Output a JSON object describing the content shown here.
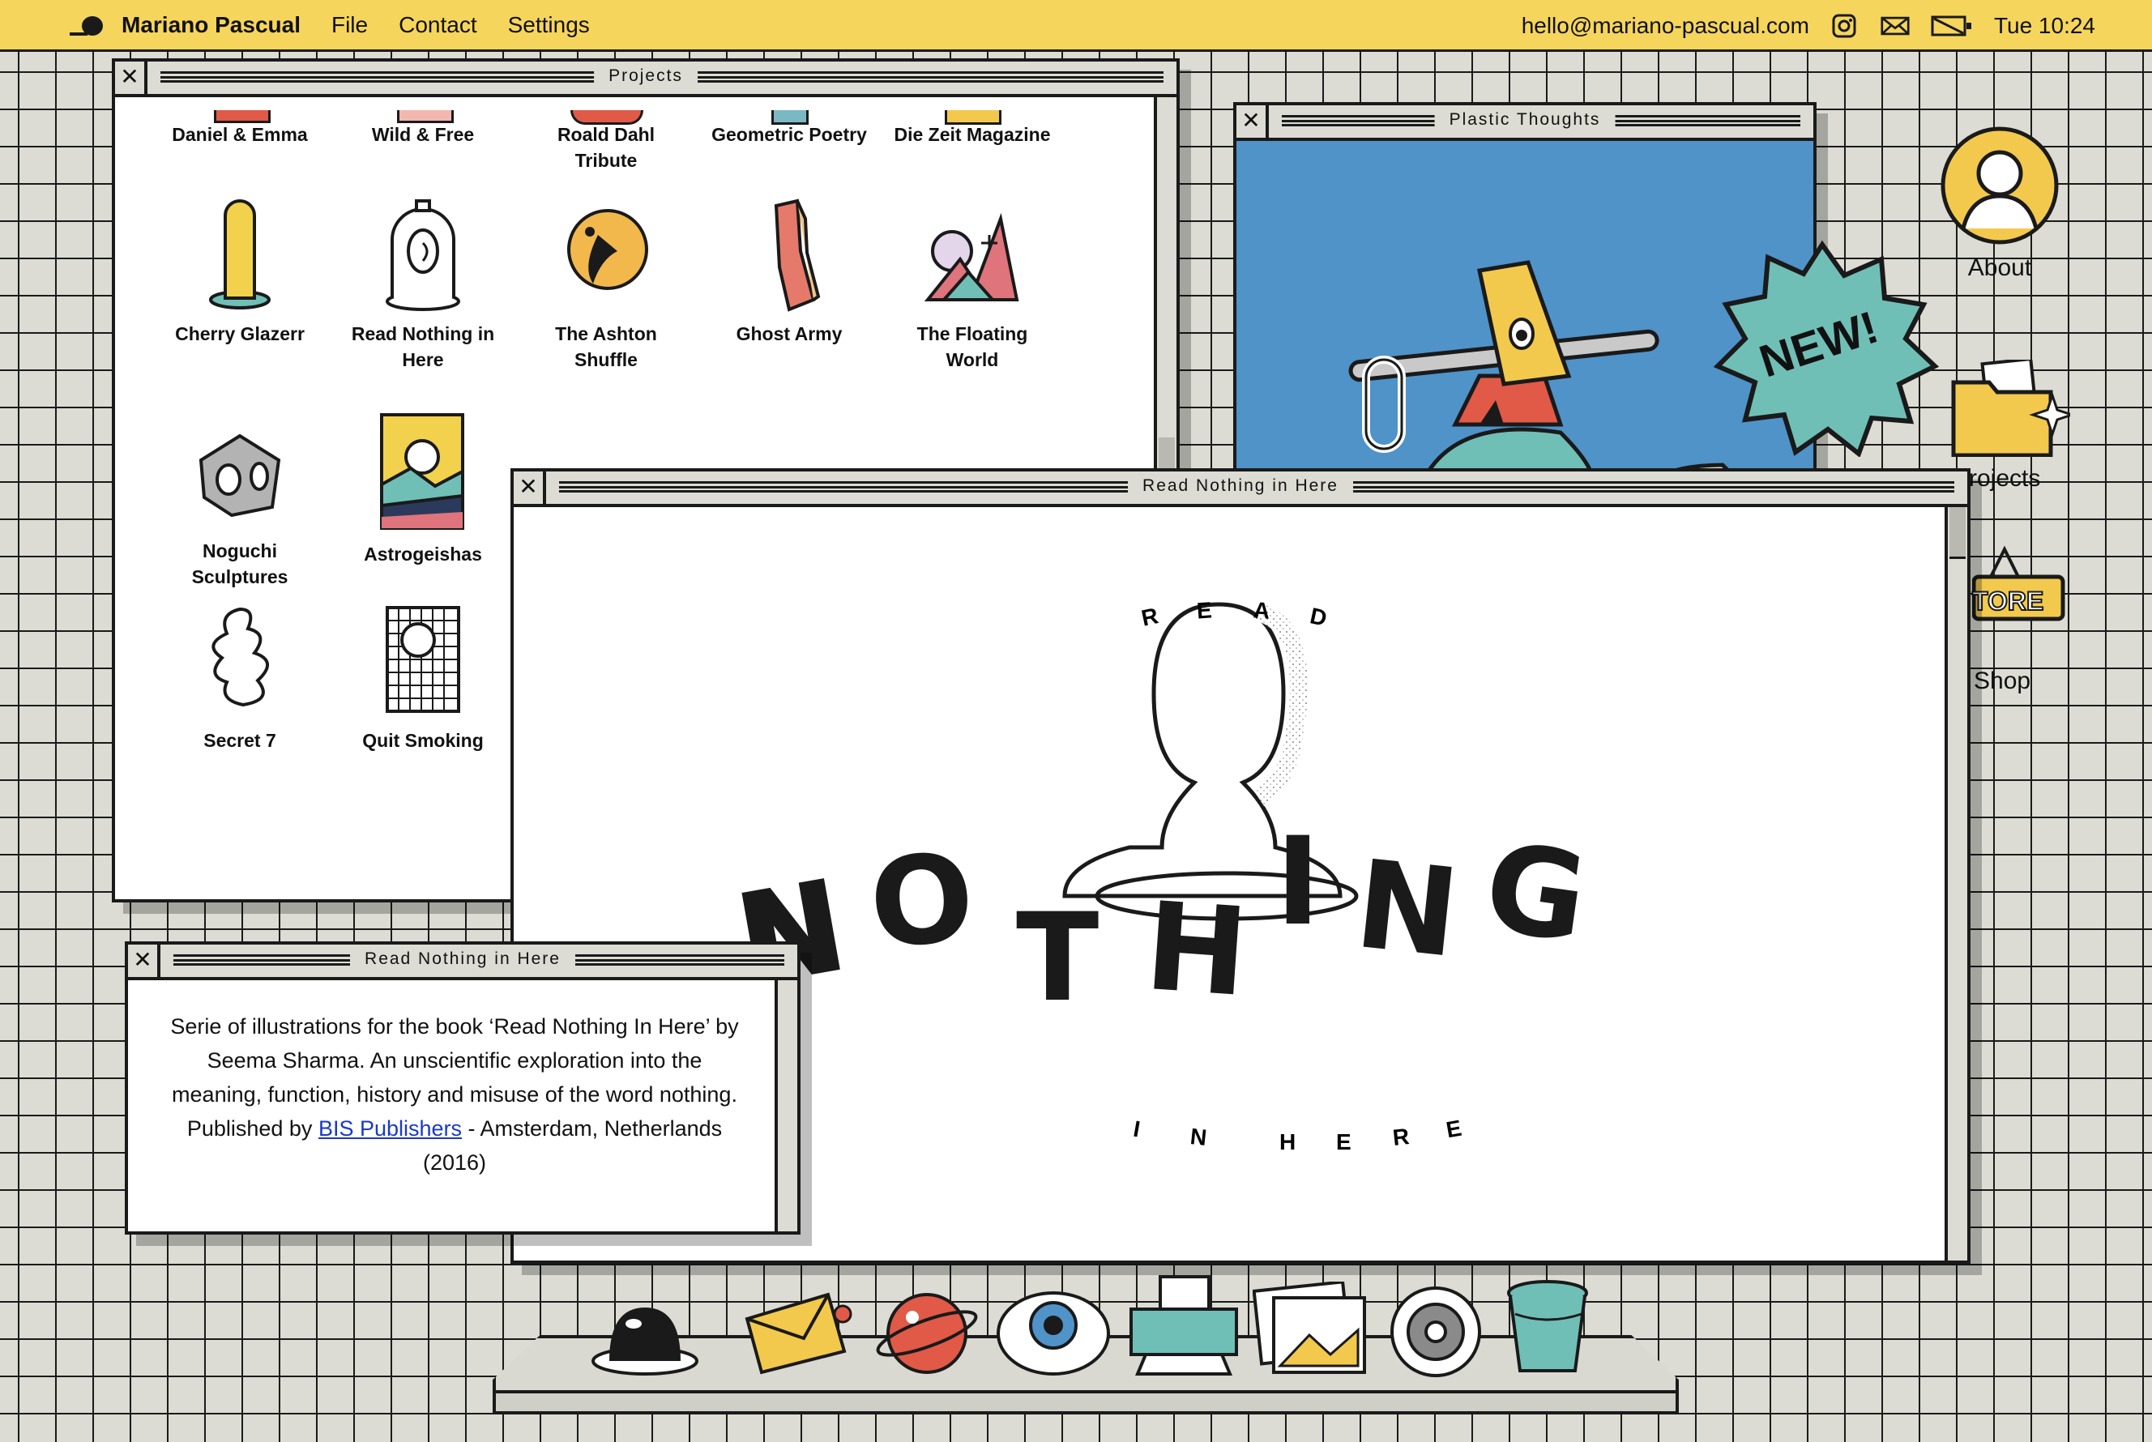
{
  "menubar": {
    "owner": "Mariano Pascual",
    "items": [
      "File",
      "Contact",
      "Settings"
    ],
    "email": "hello@mariano-pascual.com",
    "clock": "Tue 10:24",
    "icons": [
      "instagram-icon",
      "mail-icon",
      "slash-icon"
    ]
  },
  "projects_window": {
    "title": "Projects",
    "projects": [
      {
        "line1": "Daniel & Emma",
        "line2": ""
      },
      {
        "line1": "Wild & Free",
        "line2": ""
      },
      {
        "line1": "Roald Dahl",
        "line2": "Tribute"
      },
      {
        "line1": "Geometric Poetry",
        "line2": ""
      },
      {
        "line1": "Die Zeit Magazine",
        "line2": ""
      },
      {
        "line1": "Cherry Glazerr",
        "line2": ""
      },
      {
        "line1": "Read Nothing in",
        "line2": "Here"
      },
      {
        "line1": "The Ashton",
        "line2": "Shuffle"
      },
      {
        "line1": "Ghost Army",
        "line2": ""
      },
      {
        "line1": "The Floating",
        "line2": "World"
      },
      {
        "line1": "Noguchi",
        "line2": "Sculptures"
      },
      {
        "line1": "Astrogeishas",
        "line2": ""
      },
      {
        "line1": "Secret 7",
        "line2": ""
      },
      {
        "line1": "Quit Smoking",
        "line2": ""
      }
    ]
  },
  "plastic_window": {
    "title": "Plastic Thoughts"
  },
  "new_badge": "NEW!",
  "main_window": {
    "title": "Read Nothing in Here",
    "art_top": [
      "R",
      "E",
      "A",
      "D"
    ],
    "art_main": [
      "N",
      "O",
      "T",
      "H",
      "I",
      "N",
      "G"
    ],
    "art_bottom": [
      "I",
      "N",
      "H",
      "E",
      "R",
      "E"
    ]
  },
  "desc_window": {
    "title": "Read Nothing in Here",
    "text_before": "Serie of illustrations for the book ‘Read Nothing In Here’ by Seema Sharma. An unscientific exploration into the meaning, function, history and misuse of the word nothing. Published by ",
    "link": "BIS Publishers",
    "text_after": " - Amsterdam, Netherlands (2016)"
  },
  "desktop": {
    "about": "About",
    "projects": "rojects",
    "store_sign": "TORE",
    "shop": "Shop"
  },
  "dock": [
    "hole-icon",
    "mail-icon",
    "planet-icon",
    "eye-icon",
    "printer-icon",
    "photos-icon",
    "gear-icon",
    "trash-icon"
  ],
  "colors": {
    "menubar": "#f5d55c",
    "desktop": "#dcdcd4",
    "plastic_bg": "#4f93c9",
    "badge": "#6fbfb7",
    "link": "#1a39c9"
  }
}
